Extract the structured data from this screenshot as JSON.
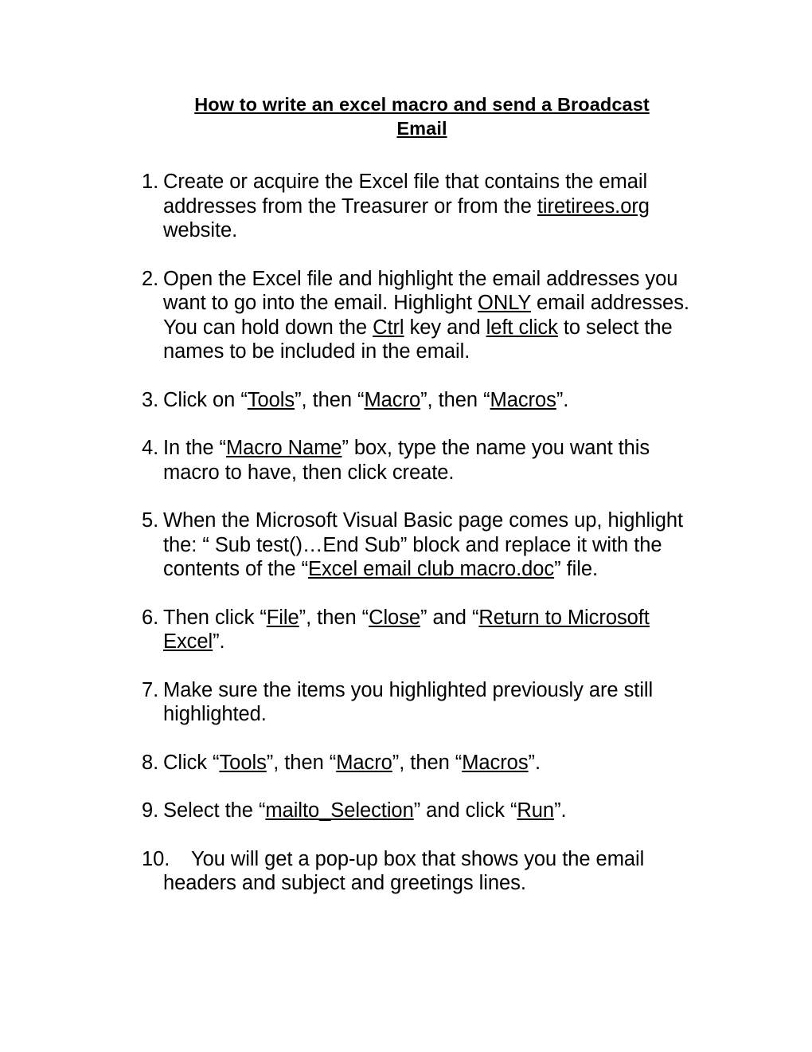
{
  "document": {
    "title_line_1": "How to write an excel macro and send a Broadcast",
    "title_line_2": "Email",
    "title_full": "How to write an excel macro and send a Broadcast Email"
  },
  "steps": [
    {
      "number": "1.",
      "text": "Create or acquire the Excel file that contains the email addresses from the Treasurer or from the tiretirees.org website.",
      "segments": [
        {
          "t": "Create or acquire the Excel file that contains the email addresses from the Treasurer or from the ",
          "u": false
        },
        {
          "t": "tiretirees.org",
          "u": true
        },
        {
          "t": " website.",
          "u": false
        }
      ]
    },
    {
      "number": "2.",
      "text": "Open the Excel file and highlight the email addresses you want to go into the email. Highlight ONLY email addresses. You can hold down the Ctrl key and left click to select the names to be included in the email.",
      "segments": [
        {
          "t": "Open the Excel file and highlight the email addresses you want to go into the email. Highlight ",
          "u": false
        },
        {
          "t": "ONLY",
          "u": true
        },
        {
          "t": " email addresses. You can hold down the ",
          "u": false
        },
        {
          "t": "Ctrl",
          "u": true
        },
        {
          "t": " key and ",
          "u": false
        },
        {
          "t": "left click",
          "u": true
        },
        {
          "t": " to select the names to be included in the email.",
          "u": false
        }
      ]
    },
    {
      "number": "3.",
      "text": "Click on “Tools”, then “Macro”, then “Macros”.",
      "segments": [
        {
          "t": "Click on “",
          "u": false
        },
        {
          "t": "Tools",
          "u": true
        },
        {
          "t": "”, then “",
          "u": false
        },
        {
          "t": "Macro",
          "u": true
        },
        {
          "t": "”, then “",
          "u": false
        },
        {
          "t": "Macros",
          "u": true
        },
        {
          "t": "”.",
          "u": false
        }
      ]
    },
    {
      "number": "4.",
      "text": "In the “Macro Name” box, type the name you want this macro to have, then click create.",
      "segments": [
        {
          "t": "In the “",
          "u": false
        },
        {
          "t": "Macro Name",
          "u": true
        },
        {
          "t": "” box, type the name you want this macro to have, then click create.",
          "u": false
        }
      ]
    },
    {
      "number": "5.",
      "text": "When the Microsoft Visual Basic page comes up, highlight the: “ Sub test()…End Sub” block and replace it with the contents of the “Excel email club macro.doc” file.",
      "segments": [
        {
          "t": "When the Microsoft Visual Basic page comes up, highlight the: “ Sub test()…End Sub” block and replace it with the contents of the “",
          "u": false
        },
        {
          "t": "Excel email club macro.doc",
          "u": true
        },
        {
          "t": "” file.",
          "u": false
        }
      ]
    },
    {
      "number": "6.",
      "text": "Then click “File”, then “Close” and “Return to Microsoft Excel”.",
      "segments": [
        {
          "t": "Then click “",
          "u": false
        },
        {
          "t": "File",
          "u": true
        },
        {
          "t": "”, then “",
          "u": false
        },
        {
          "t": "Close",
          "u": true
        },
        {
          "t": "” and “",
          "u": false
        },
        {
          "t": "Return to Microsoft Excel",
          "u": true
        },
        {
          "t": "”.",
          "u": false
        }
      ]
    },
    {
      "number": "7.",
      "text": "Make sure the items you highlighted previously are still highlighted.",
      "segments": [
        {
          "t": "Make sure the items you highlighted previously are still highlighted.",
          "u": false
        }
      ]
    },
    {
      "number": "8.",
      "text": "Click “Tools”, then “Macro”, then “Macros”.",
      "segments": [
        {
          "t": "Click “",
          "u": false
        },
        {
          "t": "Tools",
          "u": true
        },
        {
          "t": "”, then “",
          "u": false
        },
        {
          "t": "Macro",
          "u": true
        },
        {
          "t": "”, then “",
          "u": false
        },
        {
          "t": "Macros",
          "u": true
        },
        {
          "t": "”.",
          "u": false
        }
      ]
    },
    {
      "number": "9.",
      "text": "Select the “mailto_Selection” and click “Run”.",
      "segments": [
        {
          "t": "Select the “",
          "u": false
        },
        {
          "t": "mailto_Selection",
          "u": true
        },
        {
          "t": "” and click “",
          "u": false
        },
        {
          "t": "Run",
          "u": true
        },
        {
          "t": "”.",
          "u": false
        }
      ]
    },
    {
      "number": "10.",
      "wide_marker": true,
      "text": "You will get a pop-up box that shows you the email headers and subject and greetings lines.",
      "segments": [
        {
          "t": "You will get a pop-up box that shows you the email headers and subject and greetings lines.",
          "u": false
        }
      ]
    }
  ]
}
